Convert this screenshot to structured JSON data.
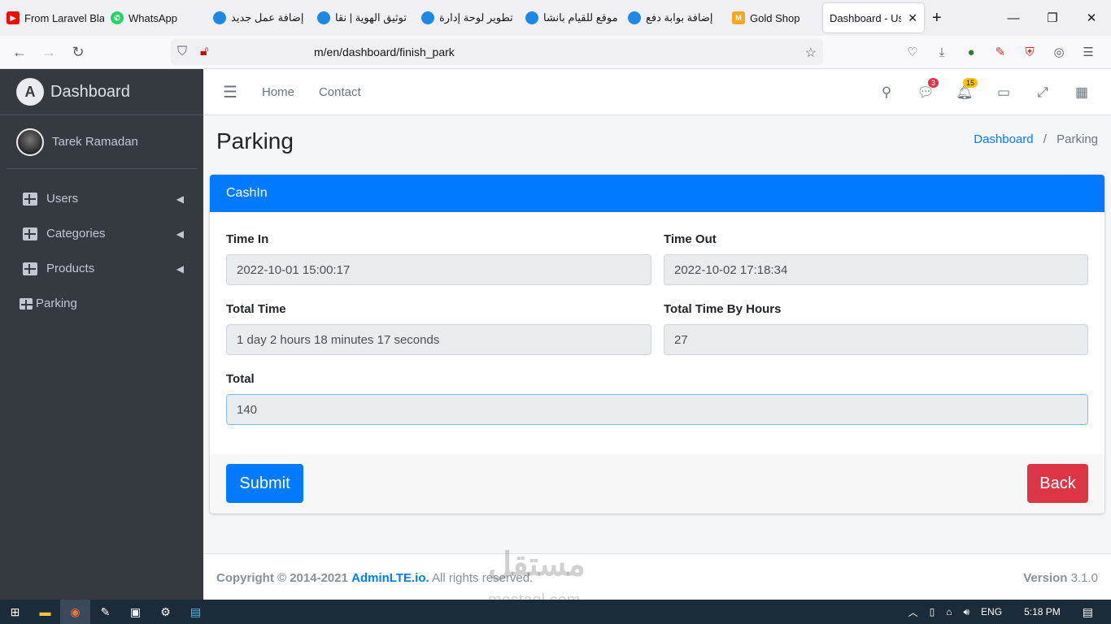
{
  "browser": {
    "tabs": [
      {
        "label": "From Laravel Bla",
        "icon": "youtube-icon",
        "color": "#ff0000"
      },
      {
        "label": "WhatsApp",
        "icon": "whatsapp-icon",
        "color": "#25d366"
      },
      {
        "label": "إضافة عمل جديد",
        "icon": "mostaql-icon",
        "color": "#1e88e5"
      },
      {
        "label": "توثيق الهوية | نقا",
        "icon": "mostaql-icon",
        "color": "#1e88e5"
      },
      {
        "label": "تطوير لوحة إدارة",
        "icon": "mostaql-icon",
        "color": "#1e88e5"
      },
      {
        "label": "موقع للقيام بانشا",
        "icon": "mostaql-icon",
        "color": "#1e88e5"
      },
      {
        "label": "إضافة بوابة دفع",
        "icon": "mostaql-icon",
        "color": "#1e88e5"
      },
      {
        "label": "Gold Shop",
        "icon": "shop-icon",
        "color": "#f5a623"
      },
      {
        "label": "Dashboard - User",
        "icon": "",
        "color": ""
      }
    ],
    "url": "m/en/dashboard/finish_park"
  },
  "sidebar": {
    "brand": "Dashboard",
    "user": "Tarek Ramadan",
    "items": [
      {
        "label": "Users"
      },
      {
        "label": "Categories"
      },
      {
        "label": "Products"
      },
      {
        "label": "Parking"
      }
    ]
  },
  "topnav": {
    "home": "Home",
    "contact": "Contact",
    "messages_count": "3",
    "notifications_count": "15"
  },
  "header": {
    "title": "Parking",
    "breadcrumb_home": "Dashboard",
    "breadcrumb_current": "Parking"
  },
  "card": {
    "title": "CashIn",
    "time_in_label": "Time In",
    "time_in_value": "2022-10-01 15:00:17",
    "time_out_label": "Time Out",
    "time_out_value": "2022-10-02 17:18:34",
    "total_time_label": "Total Time",
    "total_time_value": "1 day 2 hours 18 minutes 17 seconds",
    "total_hours_label": "Total Time By Hours",
    "total_hours_value": "27",
    "total_label": "Total",
    "total_value": "140",
    "submit": "Submit",
    "back": "Back"
  },
  "footer": {
    "copyright_prefix": "Copyright © 2014-2021",
    "copyright_link": "AdminLTE.io.",
    "copyright_suffix": "All rights reserved.",
    "version_label": "Version",
    "version_value": "3.1.0"
  },
  "watermark": {
    "arabic": "مستقل",
    "latin": "mostaql.com"
  },
  "taskbar": {
    "lang": "ENG",
    "time": "5:18 PM"
  }
}
